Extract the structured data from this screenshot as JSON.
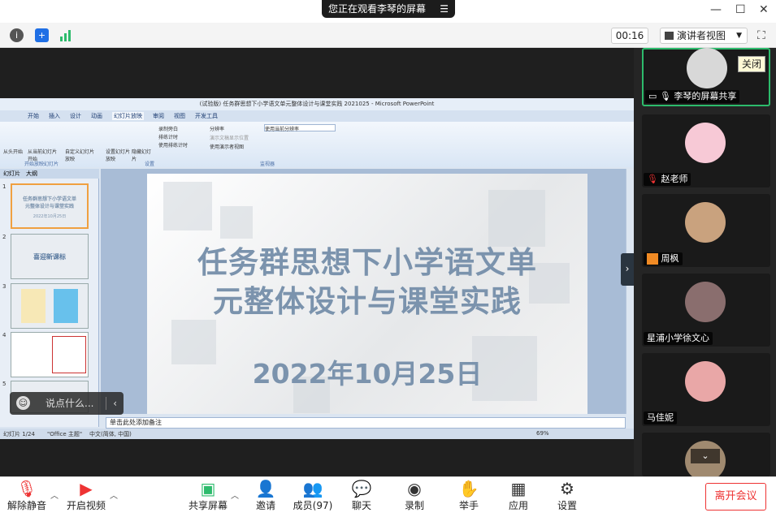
{
  "banner": {
    "text": "您正在观看李琴的屏幕",
    "menu_icon": "menu-lines-icon"
  },
  "toolbar": {
    "timer": "00:16",
    "view_button": "演讲者视图"
  },
  "ppt": {
    "window_title": "(试验版) 任务群思想下小学语文单元整体设计与课堂实践 2021025 - Microsoft PowerPoint",
    "tabs": [
      "开始",
      "插入",
      "设计",
      "动画",
      "幻灯片放映",
      "审阅",
      "视图",
      "开发工具"
    ],
    "ribbon": {
      "from_start": "从头开始",
      "from_current": "从当前幻灯片开始",
      "custom": "自定义幻灯片放映",
      "setup": "设置幻灯片放映",
      "hide": "隐藏幻灯片",
      "record": "录制旁白",
      "rehearse": "排练计时",
      "use_timings": "使用排练计时",
      "resolution": "分辨率",
      "resolution_value": "使用当前分辨率",
      "show_on": "演示文稿显示位置",
      "presenter": "使用演示者视图",
      "group1": "开始放映幻灯片",
      "group2": "设置",
      "group3": "监视器"
    },
    "panel_tabs": [
      "幻灯片",
      "大纲"
    ],
    "thumbs": [
      {
        "num": "1",
        "line1": "任务群思想下小学语文单",
        "line2": "元整体设计与课堂实践",
        "line3": "2022年10月25日"
      },
      {
        "num": "2",
        "line1": "喜迎新课标",
        "line2": "",
        "line3": ""
      },
      {
        "num": "3",
        "line1": "",
        "line2": "",
        "line3": ""
      },
      {
        "num": "4",
        "line1": "",
        "line2": "",
        "line3": ""
      },
      {
        "num": "5",
        "line1": "",
        "line2": "",
        "line3": ""
      }
    ],
    "slide_title_1": "任务群思想下小学语文单",
    "slide_title_2": "元整体设计与课堂实践",
    "slide_date": "2022年10月25日",
    "notes": "单击此处添加备注",
    "status_left": "幻灯片 1/24",
    "status_theme": "\"Office 主题\"",
    "status_lang": "中文(简体, 中国)",
    "status_zoom": "69%"
  },
  "comment": {
    "placeholder": "说点什么..."
  },
  "participants": [
    {
      "name": "李琴的屏幕共享",
      "tooltip": "关闭",
      "avatar_color": "#d8d8d8"
    },
    {
      "name": "赵老师",
      "avatar_color": "#f7c9d6"
    },
    {
      "name": "周枫",
      "avatar_color": "#c9a27e"
    },
    {
      "name": "星浦小学徐文心",
      "avatar_color": "#8a6e6e"
    },
    {
      "name": "马佳妮",
      "avatar_color": "#e9a7a7"
    }
  ],
  "bottom": {
    "mute": "解除静音",
    "video": "开启视频",
    "share": "共享屏幕",
    "invite": "邀请",
    "members": "成员(97)",
    "chat": "聊天",
    "record": "录制",
    "raise": "举手",
    "apps": "应用",
    "settings": "设置",
    "leave": "离开会议"
  }
}
